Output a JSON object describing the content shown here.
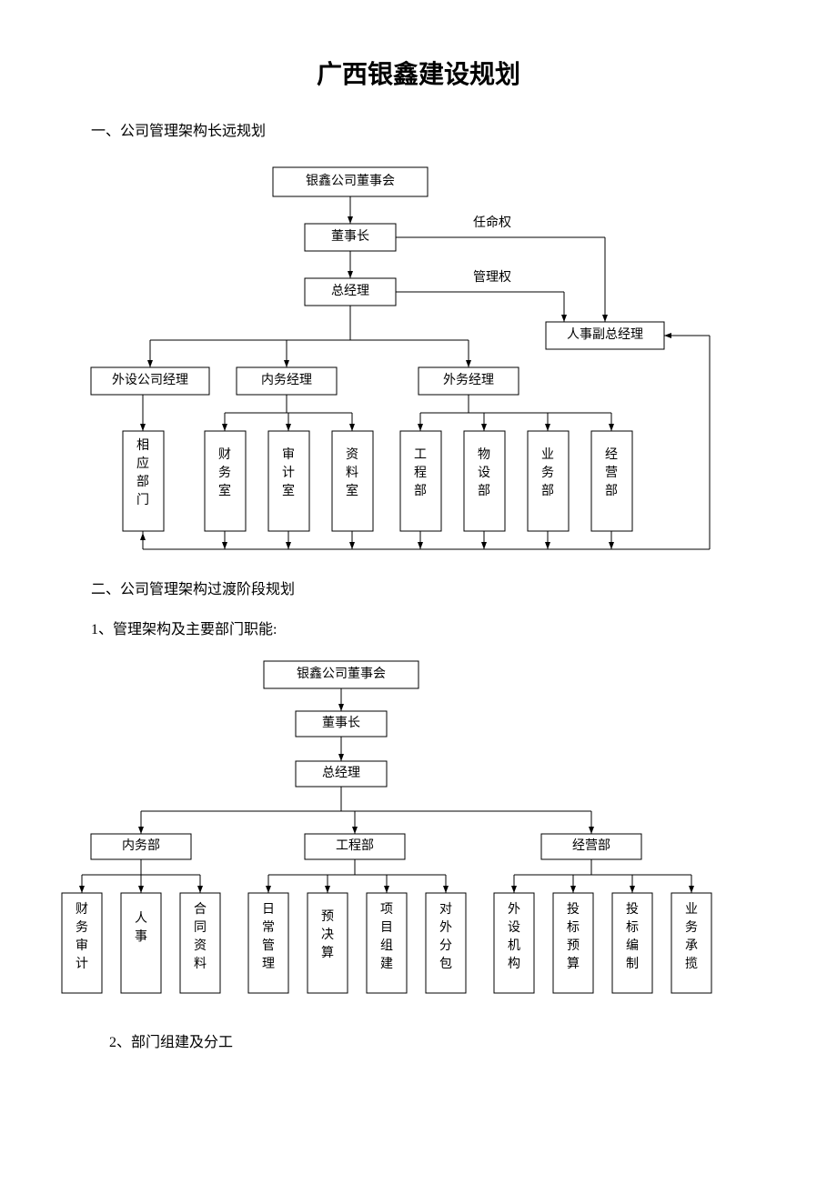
{
  "title": "广西银鑫建设规划",
  "section1": "一、公司管理架构长远规划",
  "section2": "二、公司管理架构过渡阶段规划",
  "sub2_1": "1、管理架构及主要部门职能:",
  "sub2_2": "2、部门组建及分工",
  "anno": {
    "appoint": "任命权",
    "manage": "管理权"
  },
  "chart1": {
    "top": "银鑫公司董事会",
    "chairman": "董事长",
    "gm": "总经理",
    "hr_vp": "人事副总经理",
    "ext_mgr": "外设公司经理",
    "int_mgr": "内务经理",
    "out_mgr": "外务经理",
    "depts": [
      "相应部门",
      "财务室",
      "审计室",
      "资料室",
      "工程部",
      "物设部",
      "业务部",
      "经营部"
    ]
  },
  "chart2": {
    "top": "银鑫公司董事会",
    "chairman": "董事长",
    "gm": "总经理",
    "divs": [
      "内务部",
      "工程部",
      "经营部"
    ],
    "leaves": [
      "财务审计",
      "人事",
      "合同资料",
      "日常管理",
      "预决算",
      "项目组建",
      "对外分包",
      "外设机构",
      "投标预算",
      "投标编制",
      "业务承揽"
    ]
  }
}
